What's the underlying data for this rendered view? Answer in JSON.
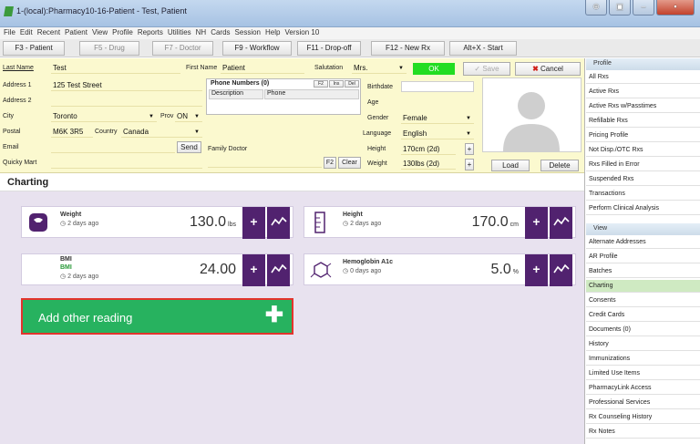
{
  "window": {
    "title": "1-(local):Pharmacy10-16-Patient - Test, Patient"
  },
  "menu": [
    "File",
    "Edit",
    "Recent",
    "Patient",
    "View",
    "Profile",
    "Reports",
    "Utilities",
    "NH",
    "Cards",
    "Session",
    "Help",
    "Version 10"
  ],
  "toolbar": {
    "tabs": [
      "F3 - Patient",
      "F5 - Drug",
      "F7 - Doctor",
      "F9 - Workflow",
      "F11 - Drop-off",
      "F12 - New Rx",
      "Alt+X - Start"
    ]
  },
  "patient": {
    "labels": {
      "last_name": "Last Name",
      "first_name": "First Name",
      "salutation": "Salutation",
      "address1": "Address 1",
      "address2": "Address 2",
      "city": "City",
      "prov": "Prov",
      "postal": "Postal",
      "country": "Country",
      "email": "Email",
      "quicky": "Quicky Mart",
      "phone_numbers": "Phone Numbers (0)",
      "description": "Description",
      "phone": "Phone",
      "family_doctor": "Family Doctor",
      "birthdate": "Birthdate",
      "age": "Age",
      "gender": "Gender",
      "language": "Language",
      "height": "Height",
      "weight": "Weight"
    },
    "values": {
      "last_name": "Test",
      "first_name": "Patient",
      "salutation": "Mrs.",
      "address1": "125 Test Street",
      "city": "Toronto",
      "prov": "ON",
      "postal": "M6K 3R5",
      "country": "Canada",
      "gender": "Female",
      "language": "English",
      "height": "170cm (2d)",
      "weight": "130lbs (2d)"
    },
    "buttons": {
      "ok": "OK",
      "save": "Save",
      "cancel": "Cancel",
      "send": "Send",
      "f2": "F2",
      "clear": "Clear",
      "load": "Load",
      "delete": "Delete",
      "phone_f2": "F2",
      "phone_ins": "Ins",
      "phone_del": "Del"
    }
  },
  "charting": {
    "header": "Charting",
    "readings": [
      {
        "name": "Weight",
        "sub": "",
        "ago": "2 days ago",
        "value": "130.0",
        "unit": "lbs"
      },
      {
        "name": "Height",
        "sub": "",
        "ago": "2 days ago",
        "value": "170.0",
        "unit": "cm"
      },
      {
        "name": "BMI",
        "sub": "BMI",
        "ago": "2 days ago",
        "value": "24.00",
        "unit": ""
      },
      {
        "name": "Hemoglobin A1c",
        "sub": "",
        "ago": "0 days ago",
        "value": "5.0",
        "unit": "%"
      }
    ],
    "add_label": "Add other reading"
  },
  "sidebar": {
    "profile_header": "Profile",
    "profile_items": [
      "All Rxs",
      "Active Rxs",
      "Active Rxs w/Passtimes",
      "Refillable Rxs",
      "Pricing Profile",
      "Not Disp./OTC Rxs",
      "Rxs Filled in Error",
      "Suspended Rxs",
      "Transactions",
      "Perform Clinical Analysis"
    ],
    "view_header": "View",
    "view_items": [
      "Alternate Addresses",
      "AR Profile",
      "Batches",
      "Charting",
      "Consents",
      "Credit Cards",
      "Documents (0)",
      "History",
      "Immunizations",
      "Limited Use Items",
      "PharmacyLink Access",
      "Professional Services",
      "Rx Counseling History",
      "Rx Notes"
    ],
    "selected": "Charting"
  },
  "colors": {
    "accent": "#51226f",
    "ok": "#22dd22",
    "add": "#27b25f",
    "patient_bg": "#fbf9cf",
    "chart_bg": "#e8e2ef"
  }
}
